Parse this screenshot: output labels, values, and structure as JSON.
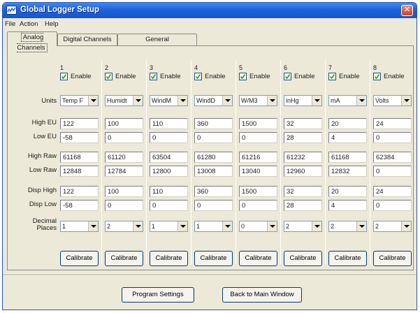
{
  "window": {
    "title": "Global Logger Setup",
    "close_glyph": "✕"
  },
  "menu": [
    "File",
    "Action",
    "Help"
  ],
  "tabs": [
    {
      "label": "Analog Channels",
      "active": true
    },
    {
      "label": "Digital Channels",
      "active": false
    },
    {
      "label": "General",
      "active": false
    }
  ],
  "row_labels": {
    "units": "Units",
    "high_eu": "High EU",
    "low_eu": "Low EU",
    "high_raw": "High Raw",
    "low_raw": "Low Raw",
    "disp_high": "Disp High",
    "disp_low": "Disp Low",
    "decimal_1": "Decimal",
    "decimal_2": "Places"
  },
  "enable_label": "Enable",
  "calibrate_label": "Calibrate",
  "channels": [
    {
      "num": "1",
      "enabled": true,
      "units": "Temp F",
      "high_eu": "122",
      "low_eu": "-58",
      "high_raw": "61168",
      "low_raw": "12848",
      "disp_high": "122",
      "disp_low": "-58",
      "decimals": "1"
    },
    {
      "num": "2",
      "enabled": true,
      "units": "Humidt",
      "high_eu": "100",
      "low_eu": "0",
      "high_raw": "61120",
      "low_raw": "12784",
      "disp_high": "100",
      "disp_low": "0",
      "decimals": "2"
    },
    {
      "num": "3",
      "enabled": true,
      "units": "WindM",
      "high_eu": "110",
      "low_eu": "0",
      "high_raw": "63504",
      "low_raw": "12800",
      "disp_high": "110",
      "disp_low": "0",
      "decimals": "1"
    },
    {
      "num": "4",
      "enabled": true,
      "units": "WindD",
      "high_eu": "360",
      "low_eu": "0",
      "high_raw": "61280",
      "low_raw": "13008",
      "disp_high": "360",
      "disp_low": "0",
      "decimals": "1"
    },
    {
      "num": "5",
      "enabled": true,
      "units": "W/M3",
      "high_eu": "1500",
      "low_eu": "0",
      "high_raw": "61216",
      "low_raw": "13040",
      "disp_high": "1500",
      "disp_low": "0",
      "decimals": "0"
    },
    {
      "num": "6",
      "enabled": true,
      "units": "inHg",
      "high_eu": "32",
      "low_eu": "28",
      "high_raw": "61232",
      "low_raw": "12960",
      "disp_high": "32",
      "disp_low": "28",
      "decimals": "2"
    },
    {
      "num": "7",
      "enabled": true,
      "units": "mA",
      "high_eu": "20",
      "low_eu": "4",
      "high_raw": "61168",
      "low_raw": "12832",
      "disp_high": "20",
      "disp_low": "4",
      "decimals": "2"
    },
    {
      "num": "8",
      "enabled": true,
      "units": "Volts",
      "high_eu": "24",
      "low_eu": "0",
      "high_raw": "62384",
      "low_raw": "0",
      "disp_high": "24",
      "disp_low": "0",
      "decimals": "2"
    }
  ],
  "footer": {
    "program_settings": "Program Settings",
    "back_to_main": "Back to Main Window"
  },
  "colors": {
    "titlebar": "#1E62DA",
    "dialog_bg": "#ECE9D8",
    "close": "#C8442A"
  }
}
